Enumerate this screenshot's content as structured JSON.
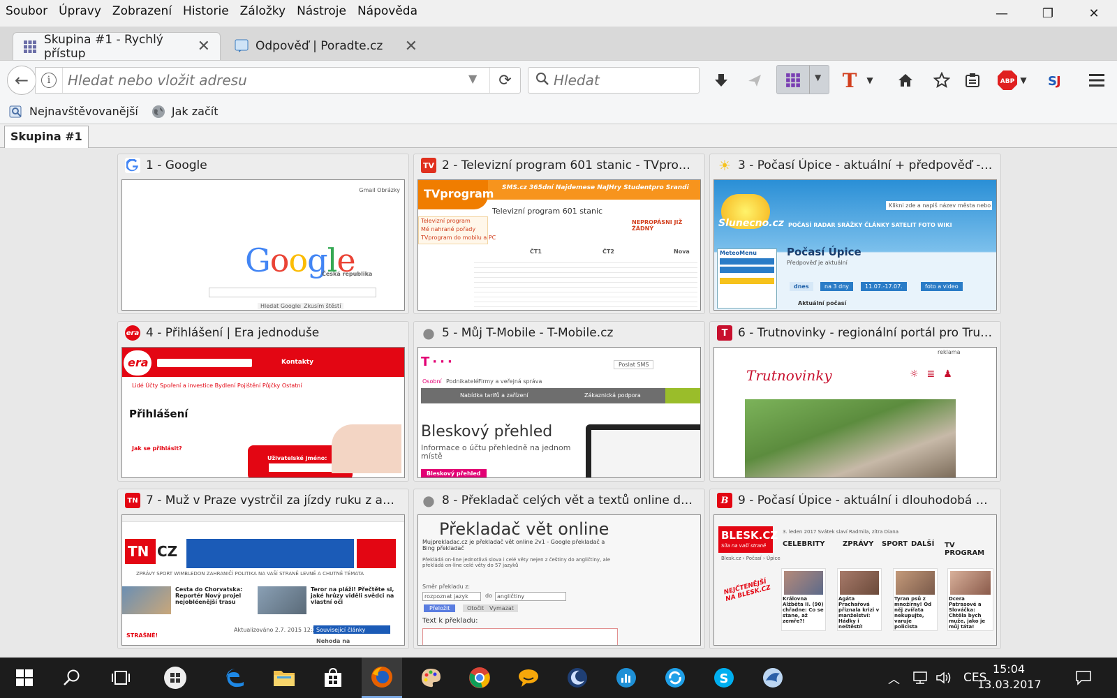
{
  "menu": [
    "Soubor",
    "Úpravy",
    "Zobrazení",
    "Historie",
    "Záložky",
    "Nástroje",
    "Nápověda"
  ],
  "tabs": [
    {
      "title": "Skupina #1 - Rychlý přístup",
      "active": true
    },
    {
      "title": "Odpověď | Poradte.cz",
      "active": false
    }
  ],
  "navbar": {
    "url_placeholder": "Hledat nebo vložit adresu",
    "search_placeholder": "Hledat",
    "abp_label": "ABP"
  },
  "bookmarks": [
    "Nejnavštěvovanější",
    "Jak začít"
  ],
  "group_tab": "Skupina #1",
  "dials": [
    {
      "title": "1 - Google",
      "fav": "G",
      "fav_color": "#ffffff"
    },
    {
      "title": "2 - Televizní program 601 stanic - TVprogram...",
      "fav": "TV",
      "fav_color": "#e0301e"
    },
    {
      "title": "3 - Počasí Úpice - aktuální + předpověď - Slu...",
      "fav": "☀",
      "fav_color": "#f6c21c"
    },
    {
      "title": "4 - Přihlášení | Era jednoduše",
      "fav": "era",
      "fav_color": "#e30613"
    },
    {
      "title": "5 - Můj T-Mobile - T-Mobile.cz",
      "fav": "●",
      "fav_color": "#8a8a8a"
    },
    {
      "title": "6 - Trutnovinky - regionální portál pro Trutno...",
      "fav": "T",
      "fav_color": "#c8102e"
    },
    {
      "title": "7 - Muž v Praze vystrčil za jízdy ruku z auta, p...",
      "fav": "TN",
      "fav_color": "#e30613"
    },
    {
      "title": "8 - Překladač celých vět a textů online do 57 j...",
      "fav": "●",
      "fav_color": "#8a8a8a"
    },
    {
      "title": "9 - Počasí Úpice - aktuální i dlouhodobá před...",
      "fav": "B",
      "fav_color": "#e30613"
    }
  ],
  "thumbs": {
    "google": {
      "logo": "Google",
      "sub": "Česká republika",
      "links": "Gmail  Obrázky",
      "btn1": "Hledat Googlem",
      "btn2": "Zkusím štěstí"
    },
    "tv": {
      "brand": "TVprogram",
      "nav": "SMS.cz   365dní   Najdemese   NaJHry   Studentpro   Srandi",
      "heading": "Televizní program 601 stanic",
      "side1": "Televizní program",
      "side2": "Mé nahrané pořady",
      "side3": "TVprogram do mobilu a PC",
      "ch1": "ČT1",
      "ch2": "ČT2",
      "ch3": "Nova",
      "warn": "NEPROPÁSNI JIŽ ŽÁDNÝ"
    },
    "slunecno": {
      "brand": "Slunecno.cz",
      "title": "Počasí Úpice",
      "sub": "Předpověď je aktuální",
      "nav": "POČASÍ   RADAR   SRÁŽKY   ČLÁNKY   SATELIT   FOTO   WIKI",
      "tab1": "dnes",
      "tab2": "na 3 dny",
      "tab3": "11.07.-17.07.",
      "tab4": "foto a video",
      "menu_title": "MeteoMenu",
      "current": "Aktuální počasí",
      "search": "Klikni zde a napiš název města nebo obce"
    },
    "era": {
      "brand": "era",
      "contacts": "Kontakty",
      "nav": "Lidé   Účty   Spoření a investice   Bydlení   Pojištění   Půjčky   Ostatní",
      "title": "Přihlášení",
      "q": "Jak se přihlásit?",
      "field": "Uživatelské jméno:"
    },
    "tmobile": {
      "nav1": "Osobní",
      "nav2": "Podnikatelé",
      "nav3": "Firmy a veřejná správa",
      "sms": "Poslat SMS",
      "bar1": "Nabídka tarifů a zařízení",
      "bar2": "Zákaznická podpora",
      "title": "Bleskový přehled",
      "sub": "Informace o účtu přehledně na jednom místě",
      "btn": "Bleskový přehled"
    },
    "trutnovinky": {
      "brand": "Trutnovinky",
      "top": "reklama"
    },
    "tn": {
      "brand": "TN",
      "brand2": "CZ",
      "nav": "ZPRÁVY   SPORT   WIMBLEDON   ZAHRANIČÍ   POLITIKA   NA VAŠÍ STRANĚ   LEVNĚ A CHUTNĚ   TÉMATA",
      "news1": "Cesta do Chorvatska: Reportér Nový projel nejobléenější trasu",
      "news2": "Teror na pláži! Přečtěte si, jaké hrůzy viděli svědci na vlastní oči",
      "foot": "STRAŠNÉ!",
      "updated": "Aktualizováno 2.7. 2015 12:21",
      "related": "Související články",
      "side": "Nehoda na"
    },
    "prekladac": {
      "title": "Překladač vět online",
      "sub": "Mujprekladac.cz je překladač vět online 2v1 - Google překladač a Bing překladač",
      "desc": "Překládá on-line jednotlivá slova i celé věty nejen z češtiny do angličtiny, ale překládá on-line celé věty do 57 jazyků",
      "dir": "Směr překladu z:",
      "from": "rozpoznat jazyk",
      "to_word": "do",
      "to": "angličtiny",
      "btn1": "Přeložit",
      "btn2": "Otočit",
      "btn3": "Vymazat",
      "label": "Text k překladu:"
    },
    "blesk": {
      "brand": "BLESK.CZ",
      "slogan": "Síla na vaší straně",
      "date": "3. leden 2017   Svátek slaví Radmila, zítra Diana",
      "nav1": "CELEBRITY",
      "nav2": "ZPRÁVY",
      "nav3": "SPORT",
      "nav4": "DALŠÍ",
      "nav5": "TV PROGRAM",
      "crumb": "Blesk.cz  ›  Počasí  ›  Úpice",
      "promo": "NEJČTENĚJŠÍ NA BLESK.CZ",
      "a1": "Královna Alžběta II. (90) chřadne: Co se stane, až zemře?!",
      "a2": "Agáta Prachařová přiznala krizi v manželství: Hádky i neštěstí!",
      "a3": "Tyran psů z množírny! Od něj zvířata nekupujte, varuje policista",
      "a4": "Dcera Patrasové a Slováčka: Chtěla bych muže, jako je můj táta!"
    }
  },
  "taskbar": {
    "lang": "CES",
    "time": "15:04",
    "date": "13.03.2017"
  }
}
